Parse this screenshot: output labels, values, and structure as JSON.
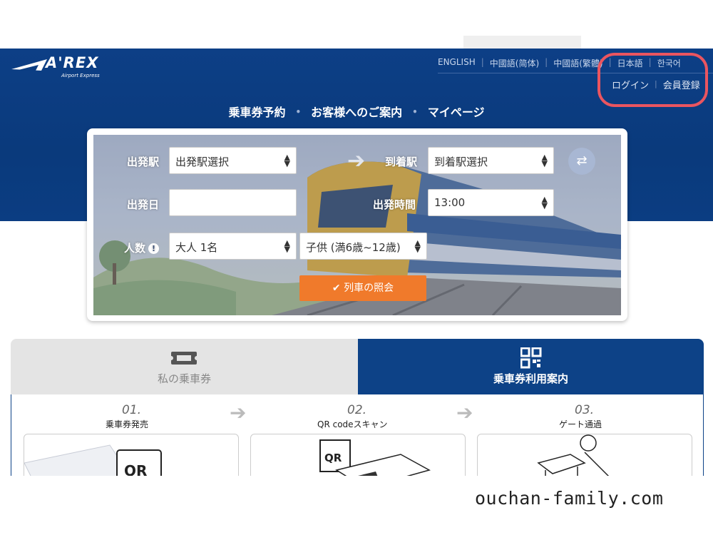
{
  "header": {
    "logo_text": "A'REX",
    "logo_sub": "Airport Express",
    "languages": [
      "ENGLISH",
      "中國語(简体)",
      "中國語(繁體)",
      "日本語",
      "한국어"
    ],
    "user_links": {
      "login": "ログイン",
      "register": "会員登録"
    },
    "nav": [
      "乗車券予約",
      "お客様へのご案内",
      "マイページ"
    ]
  },
  "search": {
    "departure_label": "出発駅",
    "departure_value": "出発駅選択",
    "arrival_label": "到着駅",
    "arrival_value": "到着駅選択",
    "date_label": "出発日",
    "date_value": "",
    "time_label": "出発時間",
    "time_value": "13:00",
    "people_label": "人数",
    "adult_value": "大人 1名",
    "child_value": "子供 (満6歳~12歳)",
    "search_button": "列車の照会"
  },
  "tabs": {
    "my_ticket": "私の乗車券",
    "ticket_guide": "乗車券利用案内"
  },
  "steps": [
    {
      "num": "01.",
      "title": "乗車券発売"
    },
    {
      "num": "02.",
      "title": "QR codeスキャン"
    },
    {
      "num": "03.",
      "title": "ゲート通過"
    }
  ],
  "watermark": "ouchan-family.com",
  "colors": {
    "header_bg": "#0b3d82",
    "accent_orange": "#f07a2b",
    "highlight_red": "#ea5560",
    "tab_active": "#0d4287"
  }
}
